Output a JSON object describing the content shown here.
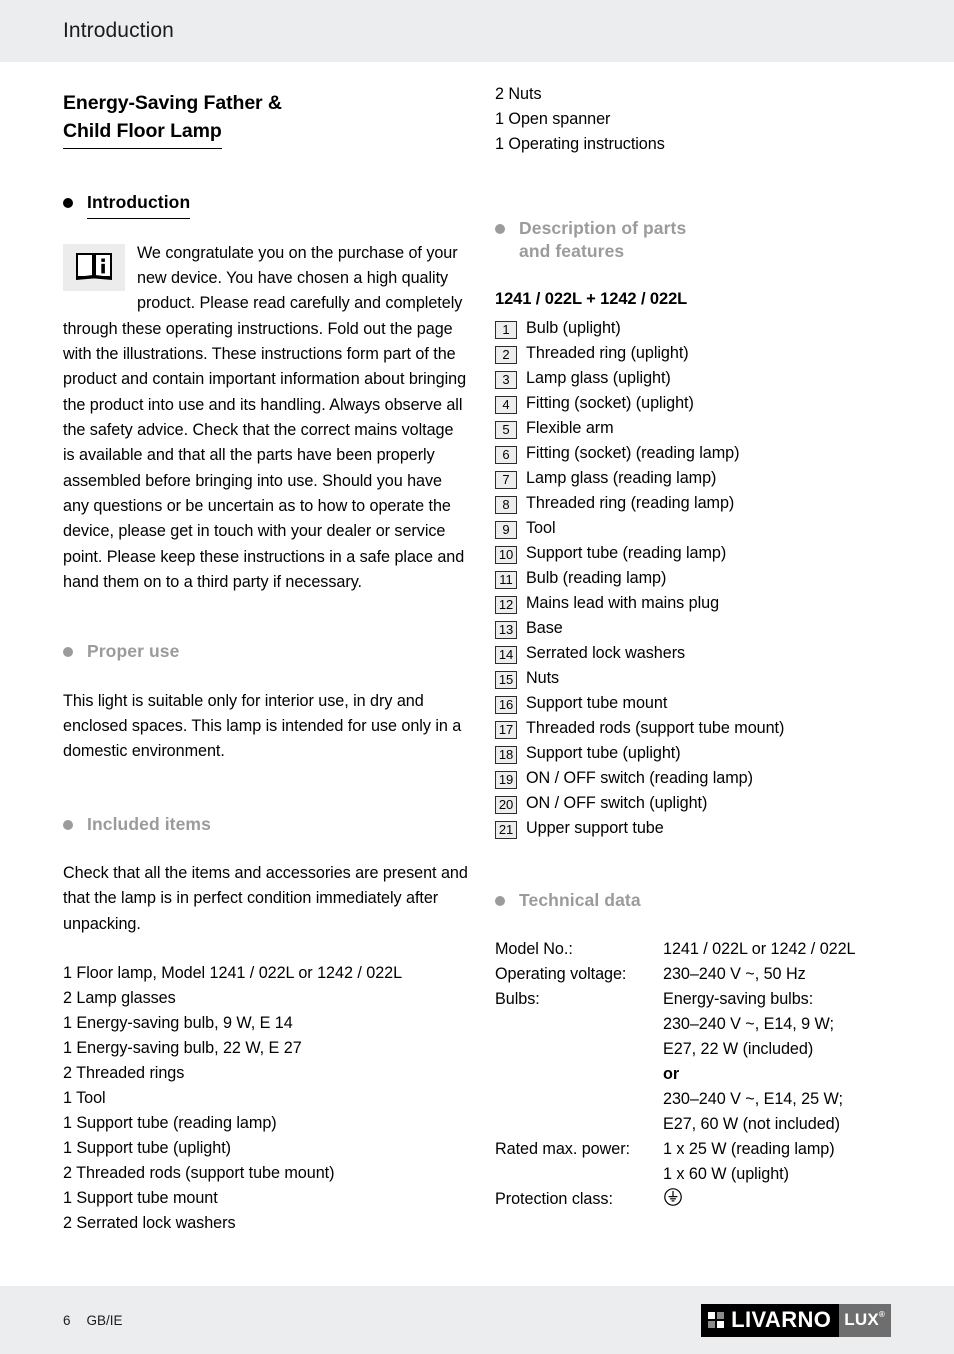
{
  "header": {
    "title": "Introduction"
  },
  "product": {
    "title_line1": "Energy-Saving Father &",
    "title_line2": "Child Floor Lamp"
  },
  "introduction": {
    "heading": "Introduction",
    "icon": "info-book-icon",
    "body": "We congratulate you on the purchase of your new device. You have chosen a high quality product. Please read carefully and completely through these operating instructions. Fold out the page with the illustrations. These instructions form part of the product and contain important information about bringing the product into use and its handling. Always observe all the safety advice. Check that the correct mains voltage is available and that all the parts have been properly assembled before bringing into use. Should you have any questions or be uncertain as to how to operate the device, please get in touch with your dealer or service point. Please keep these instructions in a safe place and hand them on to a third party if necessary."
  },
  "proper_use": {
    "heading": "Proper use",
    "body": "This light is suitable only for interior use, in dry and enclosed spaces. This lamp is intended for use only in a domestic environment."
  },
  "included_items": {
    "heading": "Included items",
    "body": "Check that all the items and accessories are present and that the lamp is in perfect condition immediately after unpacking.",
    "items_left": [
      "1 Floor lamp, Model 1241 / 022L or 1242 / 022L",
      "2 Lamp glasses",
      "1 Energy-saving bulb, 9 W, E 14",
      "1 Energy-saving bulb, 22 W, E 27",
      "2 Threaded rings",
      "1 Tool",
      "1 Support tube (reading lamp)",
      "1 Support tube (uplight)",
      "2 Threaded rods (support tube mount)",
      "1 Support tube mount",
      "2 Serrated lock washers"
    ],
    "items_right": [
      "2 Nuts",
      "1 Open spanner",
      "1 Operating instructions"
    ]
  },
  "description_of_parts": {
    "heading_line1": "Description of parts",
    "heading_line2": "and features",
    "model_line": "1241 / 022L + 1242 / 022L",
    "parts": [
      {
        "num": "1",
        "label": "Bulb (uplight)"
      },
      {
        "num": "2",
        "label": "Threaded ring (uplight)"
      },
      {
        "num": "3",
        "label": "Lamp glass (uplight)"
      },
      {
        "num": "4",
        "label": "Fitting (socket) (uplight)"
      },
      {
        "num": "5",
        "label": "Flexible arm"
      },
      {
        "num": "6",
        "label": "Fitting (socket) (reading lamp)"
      },
      {
        "num": "7",
        "label": "Lamp glass (reading lamp)"
      },
      {
        "num": "8",
        "label": "Threaded ring (reading lamp)"
      },
      {
        "num": "9",
        "label": "Tool"
      },
      {
        "num": "10",
        "label": "Support tube (reading lamp)"
      },
      {
        "num": "11",
        "label": "Bulb (reading lamp)"
      },
      {
        "num": "12",
        "label": "Mains lead with mains plug"
      },
      {
        "num": "13",
        "label": "Base"
      },
      {
        "num": "14",
        "label": "Serrated lock washers"
      },
      {
        "num": "15",
        "label": "Nuts"
      },
      {
        "num": "16",
        "label": "Support tube mount"
      },
      {
        "num": "17",
        "label": "Threaded rods (support tube mount)"
      },
      {
        "num": "18",
        "label": "Support tube (uplight)"
      },
      {
        "num": "19",
        "label": "ON / OFF switch (reading lamp)"
      },
      {
        "num": "20",
        "label": "ON / OFF switch (uplight)"
      },
      {
        "num": "21",
        "label": "Upper support tube"
      }
    ]
  },
  "technical_data": {
    "heading": "Technical data",
    "rows": [
      {
        "label": "Model No.:",
        "value": "1241 / 022L or 1242 / 022L"
      },
      {
        "label": "Operating voltage:",
        "value": "230–240 V ~, 50 Hz"
      },
      {
        "label": "Bulbs:",
        "value": "Energy-saving bulbs:"
      },
      {
        "label": "",
        "value": "230–240 V ~, E14, 9 W;"
      },
      {
        "label": "",
        "value": "E27, 22 W (included)"
      },
      {
        "label": "",
        "value": "or",
        "bold": true
      },
      {
        "label": "",
        "value": "230–240 V ~, E14, 25 W;"
      },
      {
        "label": "",
        "value": "E27, 60 W (not included)"
      },
      {
        "label": "Rated max. power:",
        "value": "1 x 25 W (reading lamp)"
      },
      {
        "label": "",
        "value": "1 x 60 W (uplight)"
      },
      {
        "label": "Protection class:",
        "value": "",
        "symbol": "protective-earth-symbol"
      }
    ]
  },
  "footer": {
    "page_number": "6",
    "locale": "GB/IE",
    "logo_word": "LIVARNO",
    "logo_suffix": "LUX",
    "logo_trademark": "®"
  }
}
